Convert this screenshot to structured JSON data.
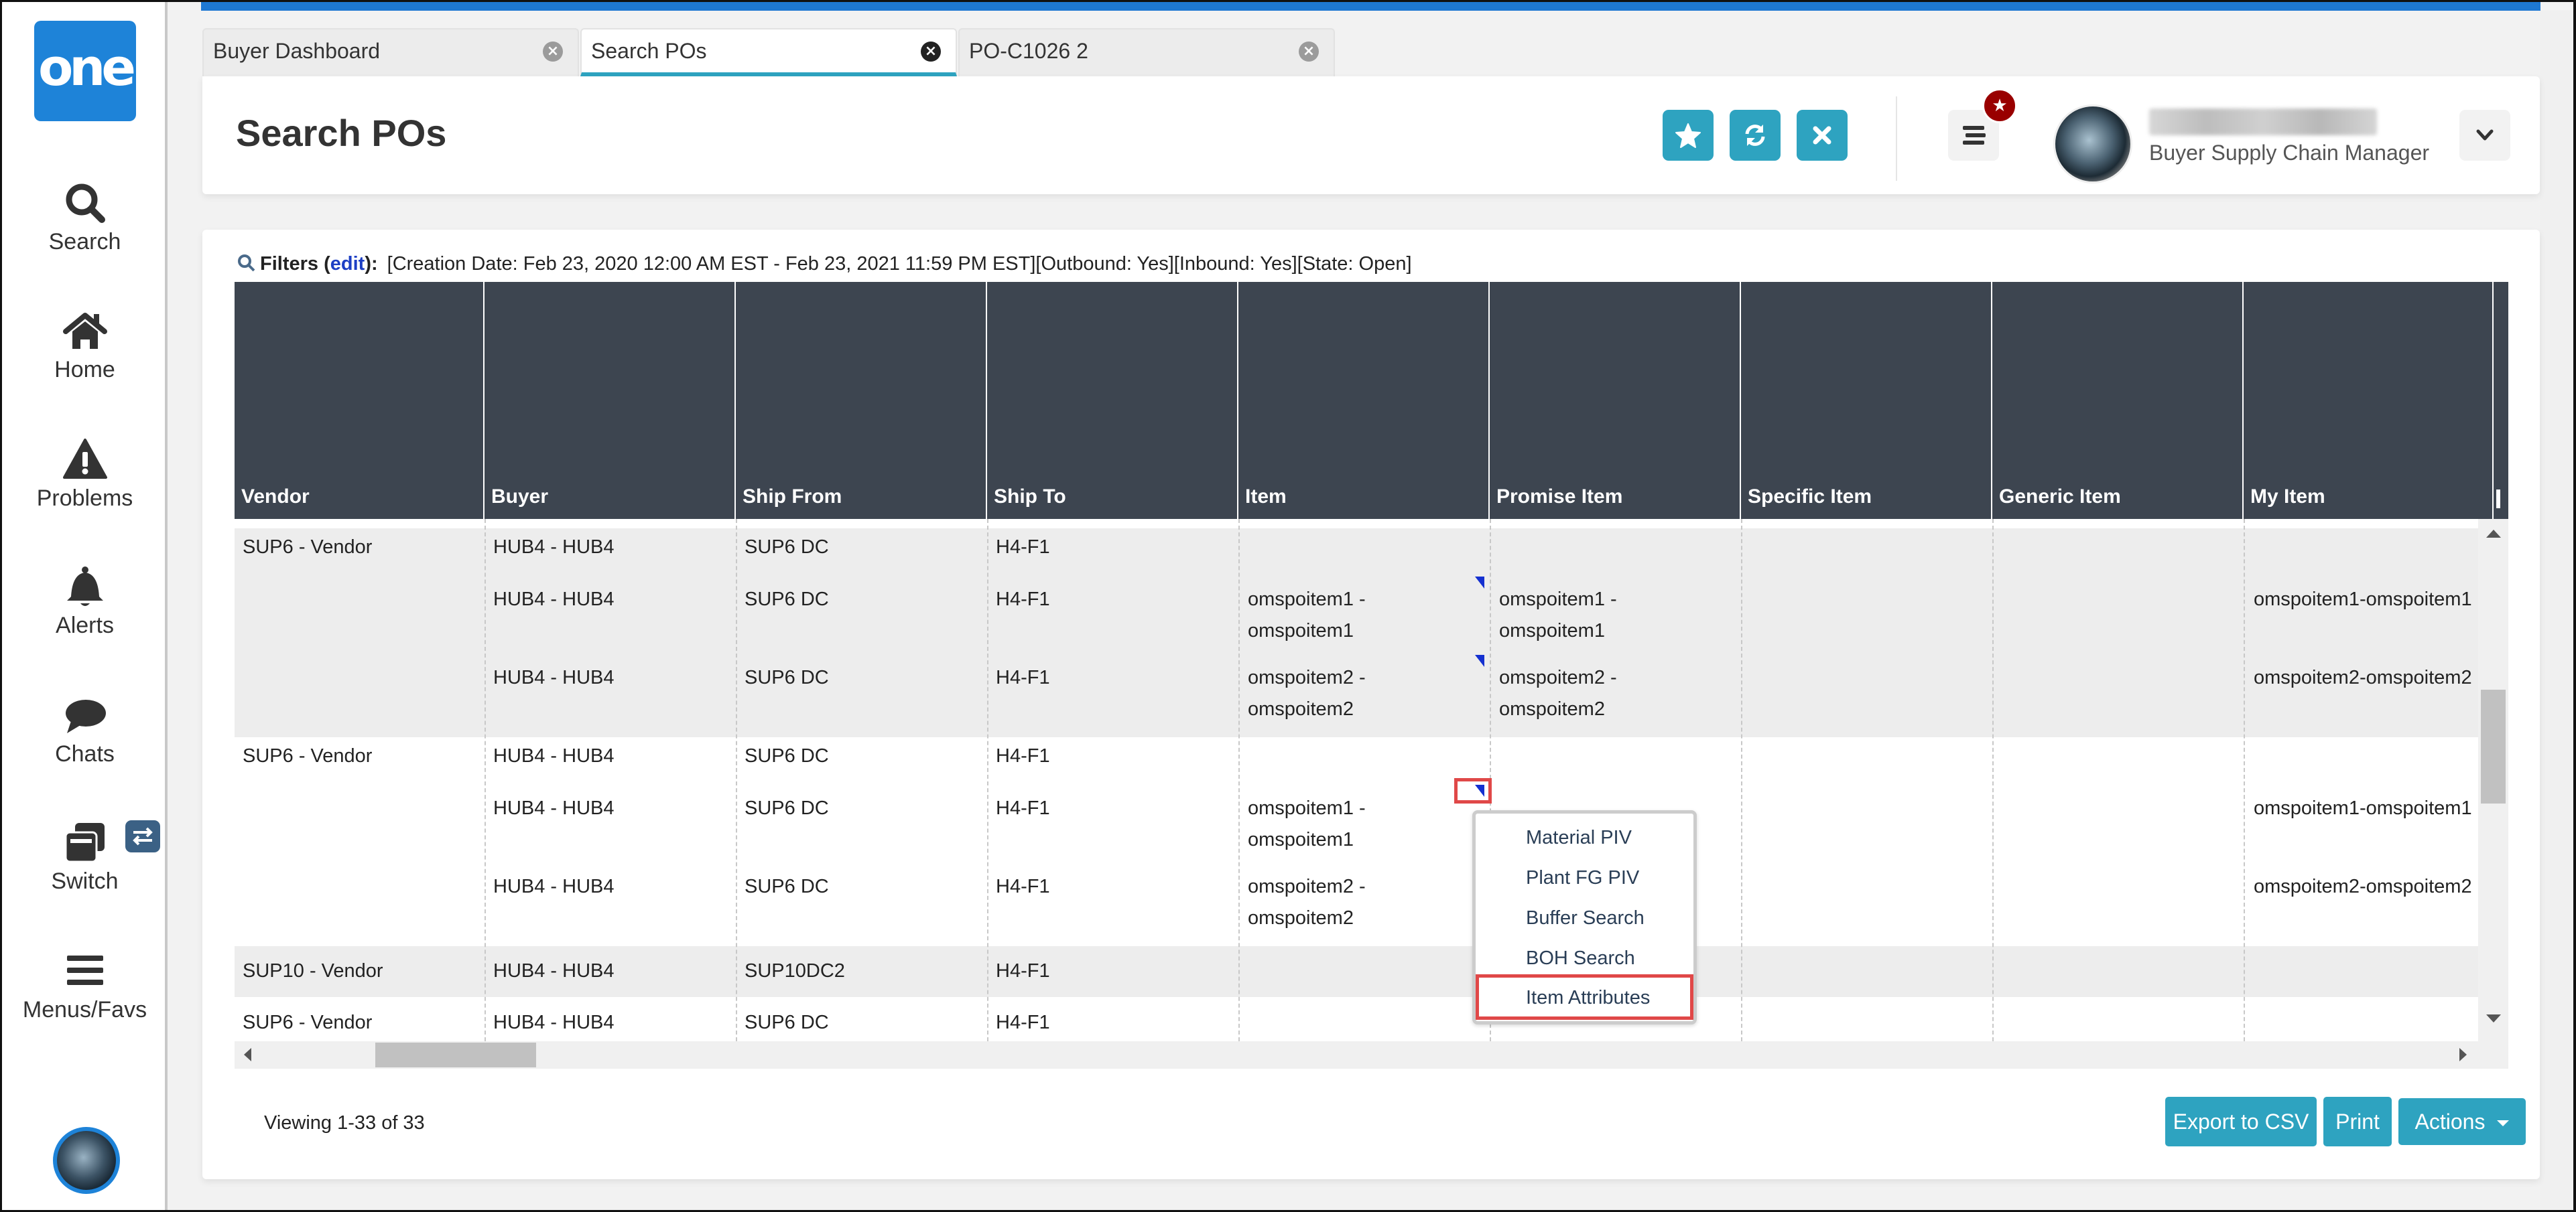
{
  "app": {
    "logo_text": "one",
    "accent_color": "#2ea3c0",
    "brand_color": "#1e83d8"
  },
  "sidebar": {
    "items": [
      {
        "label": "Search",
        "icon": "search-icon"
      },
      {
        "label": "Home",
        "icon": "home-icon"
      },
      {
        "label": "Problems",
        "icon": "warning-icon"
      },
      {
        "label": "Alerts",
        "icon": "bell-icon"
      },
      {
        "label": "Chats",
        "icon": "chat-icon"
      },
      {
        "label": "Switch",
        "icon": "switch-icon"
      },
      {
        "label": "Menus/Favs",
        "icon": "menu-icon"
      }
    ]
  },
  "tabs": [
    {
      "label": "Buyer Dashboard",
      "active": false
    },
    {
      "label": "Search POs",
      "active": true
    },
    {
      "label": "PO-C1026 2",
      "active": false
    }
  ],
  "header": {
    "title": "Search POs",
    "buttons": [
      "favorite",
      "refresh",
      "close"
    ],
    "user_role": "Buyer Supply Chain Manager"
  },
  "filters": {
    "label": "Filters (",
    "edit": "edit",
    "label_end": "):",
    "text": "[Creation Date: Feb 23, 2020 12:00 AM EST - Feb 23, 2021 11:59 PM EST][Outbound: Yes][Inbound: Yes][State: Open]"
  },
  "table": {
    "columns": [
      "Vendor",
      "Buyer",
      "Ship From",
      "Ship To",
      "Item",
      "Promise Item",
      "Specific Item",
      "Generic Item",
      "My Item"
    ],
    "rows": [
      {
        "vendor": "SUP6 - Vendor",
        "buyer": "HUB4 - HUB4",
        "ship_from": "SUP6 DC",
        "ship_to": "H4-F1",
        "item": "",
        "promise_item": "",
        "specific_item": "",
        "generic_item": "",
        "my_item": ""
      },
      {
        "vendor": "",
        "buyer": "HUB4 - HUB4",
        "ship_from": "SUP6 DC",
        "ship_to": "H4-F1",
        "item": "omspoitem1 - omspoitem1",
        "item_l1": "omspoitem1 -",
        "item_l2": "omspoitem1",
        "promise_l1": "omspoitem1 -",
        "promise_l2": "omspoitem1",
        "specific_item": "",
        "generic_item": "",
        "my_item": "omspoitem1-omspoitem1"
      },
      {
        "vendor": "",
        "buyer": "HUB4 - HUB4",
        "ship_from": "SUP6 DC",
        "ship_to": "H4-F1",
        "item": "omspoitem2 - omspoitem2",
        "item_l1": "omspoitem2 -",
        "item_l2": "omspoitem2",
        "promise_l1": "omspoitem2 -",
        "promise_l2": "omspoitem2",
        "specific_item": "",
        "generic_item": "",
        "my_item": "omspoitem2-omspoitem2"
      },
      {
        "vendor": "SUP6 - Vendor",
        "buyer": "HUB4 - HUB4",
        "ship_from": "SUP6 DC",
        "ship_to": "H4-F1",
        "item": "",
        "promise_item": "",
        "my_item": ""
      },
      {
        "vendor": "",
        "buyer": "HUB4 - HUB4",
        "ship_from": "SUP6 DC",
        "ship_to": "H4-F1",
        "item_l1": "omspoitem1 -",
        "item_l2": "omspoitem1",
        "promise_item": "",
        "my_item": "omspoitem1-omspoitem1"
      },
      {
        "vendor": "",
        "buyer": "HUB4 - HUB4",
        "ship_from": "SUP6 DC",
        "ship_to": "H4-F1",
        "item_l1": "omspoitem2 -",
        "item_l2": "omspoitem2",
        "promise_item": "",
        "my_item": "omspoitem2-omspoitem2"
      },
      {
        "vendor": "SUP10 - Vendor",
        "buyer": "HUB4 - HUB4",
        "ship_from": "SUP10DC2",
        "ship_to": "H4-F1",
        "item": "",
        "my_item": ""
      },
      {
        "vendor": "SUP6 - Vendor",
        "buyer": "HUB4 - HUB4",
        "ship_from": "SUP6 DC",
        "ship_to": "H4-F1",
        "item": "",
        "my_item": ""
      }
    ]
  },
  "context_menu": {
    "items": [
      "Material PIV",
      "Plant FG PIV",
      "Buffer Search",
      "BOH Search",
      "Item Attributes"
    ],
    "highlighted": "Item Attributes"
  },
  "footer": {
    "viewing": "Viewing 1-33 of 33",
    "export_label": "Export to CSV",
    "print_label": "Print",
    "actions_label": "Actions"
  }
}
